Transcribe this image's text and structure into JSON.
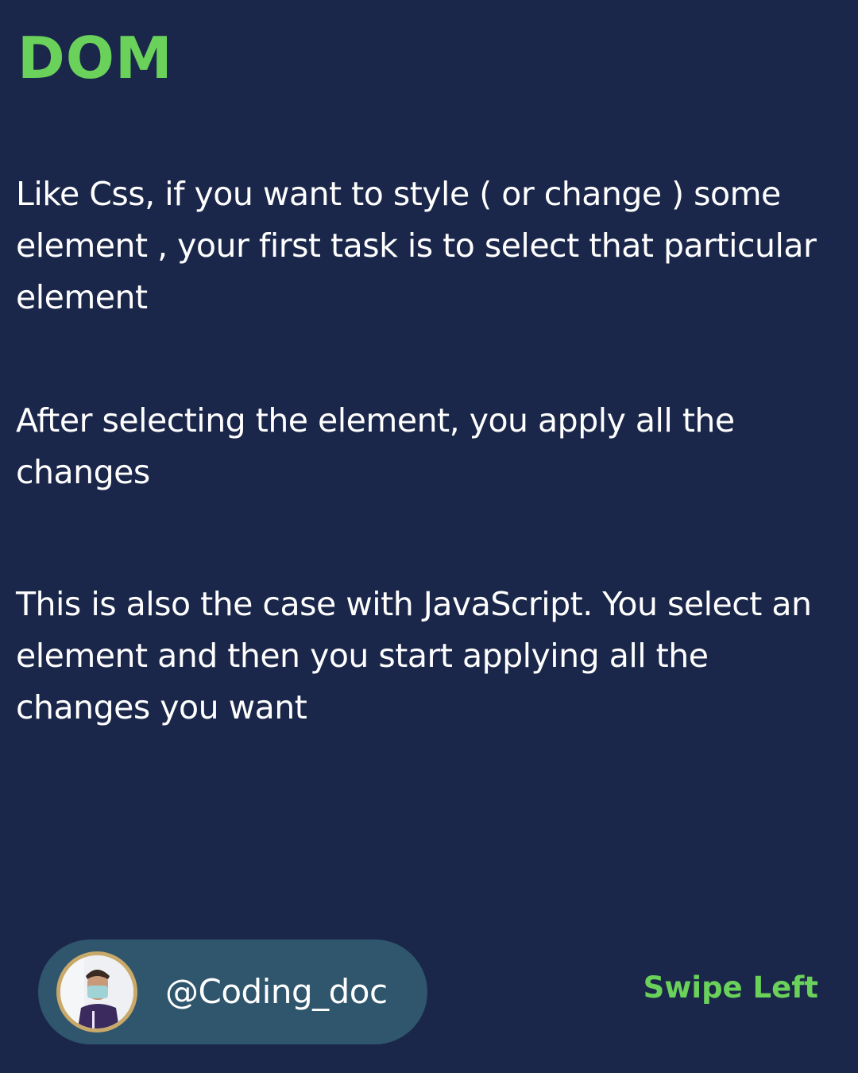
{
  "title": "DOM",
  "paragraphs": [
    "Like Css, if you want to style ( or change ) some element , your first task is to select that particular element",
    "After selecting the element, you apply all the changes",
    "This is also the case with JavaScript. You select an element and then you start applying all the changes you want"
  ],
  "profile": {
    "handle": "@Coding_doc",
    "avatar_icon": "user-avatar-photo"
  },
  "swipe_label": "Swipe Left",
  "colors": {
    "background": "#1b274a",
    "accent_green": "#6ad15a",
    "pill": "#2f566c",
    "avatar_ring": "#c9a96a",
    "text": "#ffffff"
  }
}
